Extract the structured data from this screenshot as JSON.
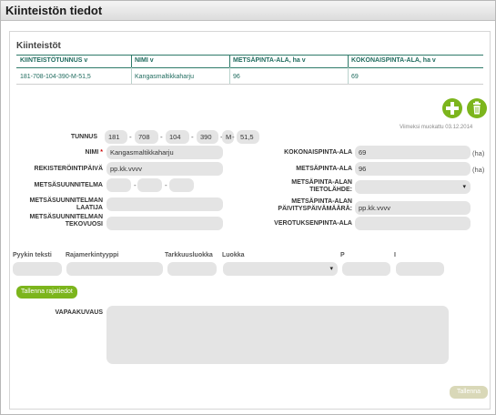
{
  "window": {
    "title": "Kiinteistön tiedot"
  },
  "section": {
    "title": "Kiinteistöt"
  },
  "table": {
    "headers": [
      "KIINTEISTÖTUNNUS v",
      "NIMI v",
      "METSÄPINTA-ALA, ha v",
      "KOKONAISPINTA-ALA, ha v"
    ],
    "rows": [
      [
        "181-708-104-390-M-51,5",
        "Kangasmaltikkaharju",
        "96",
        "69"
      ]
    ]
  },
  "actions": {
    "add_icon": "plus-circle-icon",
    "delete_icon": "trash-icon",
    "last_modified": "Viimeksi muokattu 03.12.2014"
  },
  "form": {
    "tunnus": {
      "label": "TUNNUS",
      "parts": [
        "181",
        "708",
        "104",
        "390",
        "M",
        "51,5"
      ]
    },
    "nimi": {
      "label": "NIMI",
      "required_mark": "*",
      "value": "Kangasmaltikkaharju"
    },
    "rekisterointipaiva": {
      "label": "REKISTERÖINTIPÄIVÄ",
      "value": "pp.kk.vvvv"
    },
    "metsasuunnitelma": {
      "label": "METSÄSUUNNITELMA",
      "sep": "-"
    },
    "laatija": {
      "label1": "METSÄSUUNNITELMAN",
      "label2": "LAATIJA",
      "value": ""
    },
    "tekovuosi": {
      "label1": "METSÄSUUNNITELMAN",
      "label2": "TEKOVUOSI",
      "value": ""
    },
    "kokonaispinta": {
      "label": "KOKONAISPINTA-ALA",
      "value": "69",
      "unit": "(ha)"
    },
    "metsapinta": {
      "label": "METSÄPINTA-ALA",
      "value": "96",
      "unit": "(ha)"
    },
    "tietolahde": {
      "label1": "METSÄPINTA-ALAN",
      "label2": "TIETOLÄHDE:",
      "value": ""
    },
    "paivitys": {
      "label1": "METSÄPINTA-ALAN",
      "label2": "PÄIVITYSPÄIVÄMÄÄRÄ:",
      "value": "pp.kk.vvvv"
    },
    "verotus": {
      "label": "VEROTUKSENPINTA-ALA",
      "value": ""
    }
  },
  "boundary": {
    "labels": [
      "Pyykin teksti",
      "Rajamerkintyyppi",
      "Tarkkuusluokka",
      "Luokka",
      "P",
      "I"
    ],
    "save_label": "Tallenna rajatiedot"
  },
  "description": {
    "label": "VAPAAKUVAUS",
    "value": ""
  },
  "footer": {
    "save_label": "Tallenna"
  },
  "colors": {
    "accent": "#7cb51c",
    "table_text": "#1f6b5e",
    "field_bg": "#e4e4e4"
  }
}
